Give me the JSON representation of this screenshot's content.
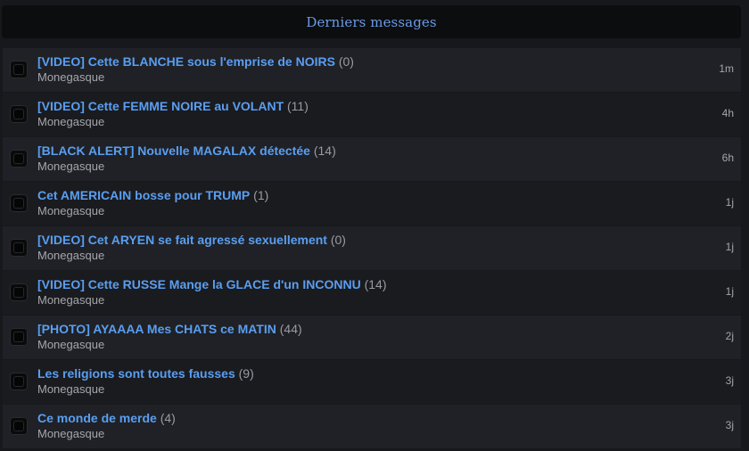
{
  "header": {
    "title": "Derniers messages"
  },
  "topics": [
    {
      "title": "[VIDEO] Cette BLANCHE sous l'emprise de NOIRS",
      "count": "(0)",
      "author": "Monegasque",
      "time": "1m"
    },
    {
      "title": "[VIDEO] Cette FEMME NOIRE au VOLANT",
      "count": "(11)",
      "author": "Monegasque",
      "time": "4h"
    },
    {
      "title": "[BLACK ALERT] Nouvelle MAGALAX détectée",
      "count": "(14)",
      "author": "Monegasque",
      "time": "6h"
    },
    {
      "title": "Cet AMERICAIN bosse pour TRUMP",
      "count": "(1)",
      "author": "Monegasque",
      "time": "1j"
    },
    {
      "title": "[VIDEO] Cet ARYEN se fait agressé sexuellement",
      "count": "(0)",
      "author": "Monegasque",
      "time": "1j"
    },
    {
      "title": "[VIDEO] Cette RUSSE Mange la GLACE d'un INCONNU",
      "count": "(14)",
      "author": "Monegasque",
      "time": "1j"
    },
    {
      "title": "[PHOTO] AYAAAA Mes CHATS ce MATIN",
      "count": "(44)",
      "author": "Monegasque",
      "time": "2j"
    },
    {
      "title": "Les religions sont toutes fausses",
      "count": "(9)",
      "author": "Monegasque",
      "time": "3j"
    },
    {
      "title": "Ce monde de merde",
      "count": "(4)",
      "author": "Monegasque",
      "time": "3j"
    }
  ]
}
